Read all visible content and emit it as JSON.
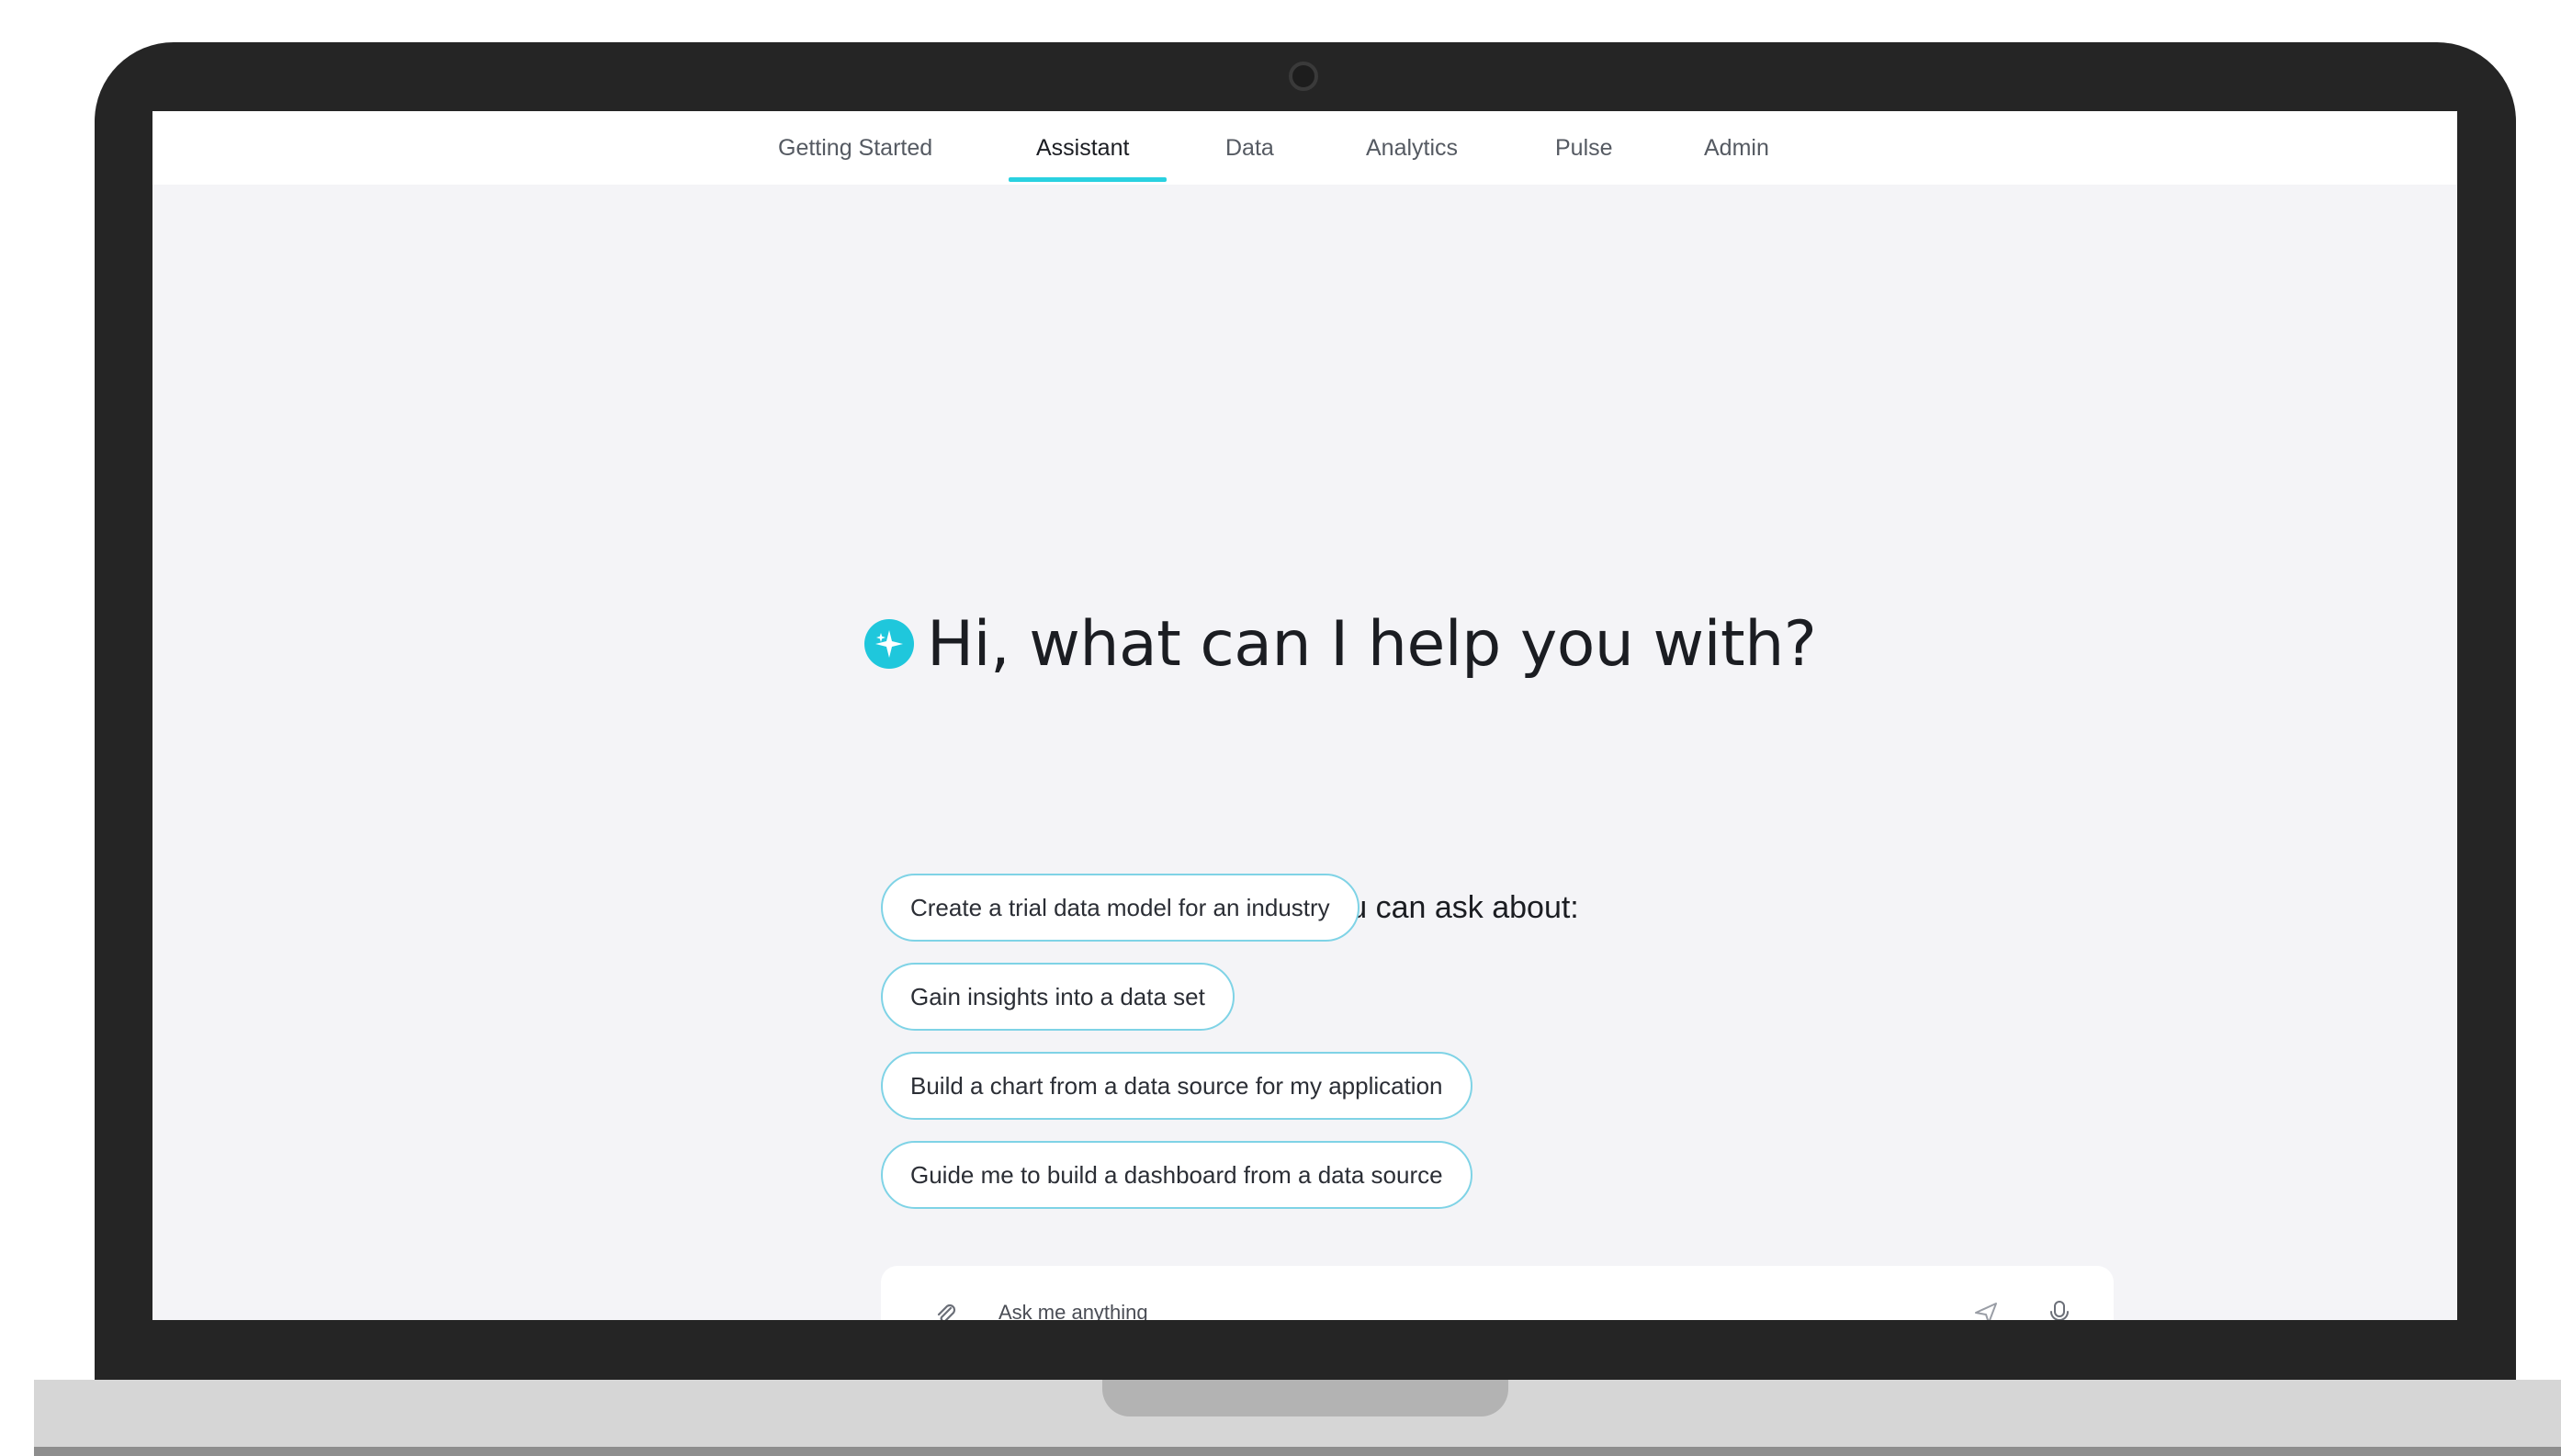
{
  "nav": {
    "tabs": [
      {
        "label": "Getting Started"
      },
      {
        "label": "Assistant",
        "active": true
      },
      {
        "label": "Data"
      },
      {
        "label": "Analytics"
      },
      {
        "label": "Pulse"
      },
      {
        "label": "Admin"
      }
    ]
  },
  "main": {
    "greeting": "Hi, what can I help you with?",
    "ideas_intro": "Below are some ideas for what you can ask about:",
    "ideas": [
      "Create a trial data model for an industry",
      "Gain insights into a data set",
      "Build a chart from a data source for my application",
      "Guide me to build a dashboard from a data source"
    ]
  },
  "ask": {
    "placeholder": "Ask me anything"
  },
  "colors": {
    "accent": "#29d1e0",
    "chip_border": "#7fd3e6",
    "screen_background": "#f4f4f7",
    "frame": "#252525"
  },
  "icons": {
    "assistant": "sparkle-icon",
    "attach": "paperclip-icon",
    "send": "send-icon",
    "voice": "microphone-icon"
  }
}
